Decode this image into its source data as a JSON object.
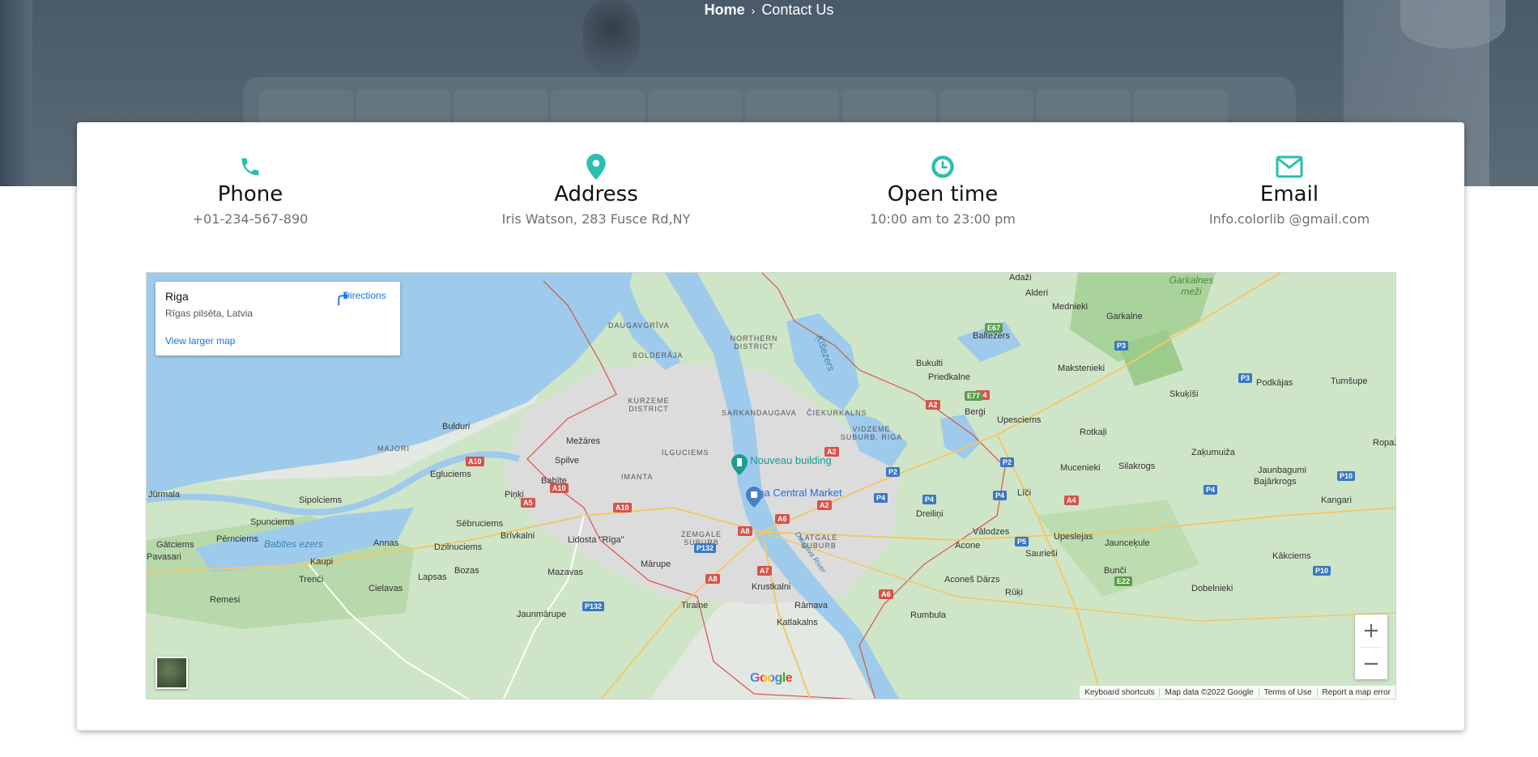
{
  "breadcrumb": {
    "home": "Home",
    "separator": "›",
    "current": "Contact Us"
  },
  "accent_color": "#2abfb0",
  "contact_items": [
    {
      "icon": "phone-icon",
      "title": "Phone",
      "value": "+01-234-567-890"
    },
    {
      "icon": "map-pin-icon",
      "title": "Address",
      "value": "Iris Watson, 283 Fusce Rd,NY"
    },
    {
      "icon": "clock-icon",
      "title": "Open time",
      "value": "10:00 am to 23:00 pm"
    },
    {
      "icon": "envelope-icon",
      "title": "Email",
      "value": "Info.colorlib @gmail.com"
    }
  ],
  "map": {
    "place_name": "Riga",
    "place_address": "Rīgas pilsēta, Latvia",
    "directions_label": "Directions",
    "view_larger_label": "View larger map",
    "zoom_in": "+",
    "zoom_out": "−",
    "google_logo": "Google",
    "footer": [
      "Keyboard shortcuts",
      "Map data ©2022 Google",
      "Terms of Use",
      "Report a map error"
    ],
    "pins": [
      {
        "label": "Art Nouveau building",
        "color": "#1a9e8f"
      },
      {
        "label": "Riga Central Market",
        "color": "#4a7fc8"
      }
    ],
    "places": [
      "Adaži",
      "Alderi",
      "Mednieki",
      "Garkalne",
      "Baltezers",
      "Bukulti",
      "Priedkalne",
      "Makstenieki",
      "Podkājas",
      "Tumšupe",
      "Skuķīši",
      "Berģi",
      "Upesciems",
      "Rotkaļi",
      "Ropaži",
      "Bulduri",
      "Mežāres",
      "Spilve",
      "Egluciems",
      "Babīte",
      "Piņķi",
      "Jūrmala",
      "Sipolciems",
      "Spunciems",
      "Pērnciems",
      "Gātciems",
      "Pavasari",
      "Kaupi",
      "Trenči",
      "Cielavas",
      "Lapsas",
      "Remesi",
      "Annas",
      "Sēbruciems",
      "Brīvkalni",
      "Dzilnuciems",
      "Bozas",
      "Mazavas",
      "Lidosta \"Rīga\"",
      "Mārupe",
      "Jaunmārupe",
      "Tiraine",
      "Krustkalni",
      "Rāmava",
      "Katlakalns",
      "Rumbula",
      "Dreiliņi",
      "Vālodzes",
      "Acone",
      "Saurieši",
      "Aconeš Dārzs",
      "Rūķi",
      "Upeslejas",
      "Jaunceķule",
      "Bunči",
      "Dobelnieki",
      "Kākciems",
      "Mucenieki",
      "Silakrogs",
      "Zaķumuiža",
      "Jaunbagumi",
      "Bajārkrogs",
      "Kangari",
      "Līči"
    ],
    "districts": [
      "DAUGAVGRĪVA",
      "BOLDERĀJA",
      "NORTHERN DISTRICT",
      "KURZEME DISTRICT",
      "SARKANDAUGAVA",
      "ČIEKURKALNS",
      "VIDZEME SUBURB, RIGA",
      "IĻĢUCIEMS",
      "IMANTA",
      "ZEMGALE SUBURB",
      "LATGALE SUBURB",
      "MAJORI"
    ],
    "water_labels": [
      "Ķīšezers",
      "Babītes ezers",
      "Daugava River",
      "Garkalnes meži"
    ],
    "road_badges": [
      {
        "text": "A10",
        "kind": "red"
      },
      {
        "text": "A10",
        "kind": "red"
      },
      {
        "text": "A10",
        "kind": "red"
      },
      {
        "text": "A5",
        "kind": "red"
      },
      {
        "text": "A8",
        "kind": "red"
      },
      {
        "text": "A8",
        "kind": "red"
      },
      {
        "text": "A7",
        "kind": "red"
      },
      {
        "text": "A6",
        "kind": "red"
      },
      {
        "text": "A6",
        "kind": "red"
      },
      {
        "text": "A2",
        "kind": "red"
      },
      {
        "text": "A2",
        "kind": "red"
      },
      {
        "text": "A2",
        "kind": "red"
      },
      {
        "text": "A4",
        "kind": "red"
      },
      {
        "text": "A4",
        "kind": "red"
      },
      {
        "text": "P2",
        "kind": "blue"
      },
      {
        "text": "P2",
        "kind": "blue"
      },
      {
        "text": "P3",
        "kind": "blue"
      },
      {
        "text": "P3",
        "kind": "blue"
      },
      {
        "text": "P4",
        "kind": "blue"
      },
      {
        "text": "P4",
        "kind": "blue"
      },
      {
        "text": "P4",
        "kind": "blue"
      },
      {
        "text": "P4",
        "kind": "blue"
      },
      {
        "text": "P5",
        "kind": "blue"
      },
      {
        "text": "P10",
        "kind": "blue"
      },
      {
        "text": "P10",
        "kind": "blue"
      },
      {
        "text": "P132",
        "kind": "blue"
      },
      {
        "text": "P132",
        "kind": "blue"
      },
      {
        "text": "E67",
        "kind": "green"
      },
      {
        "text": "E77",
        "kind": "green"
      },
      {
        "text": "E22",
        "kind": "green"
      }
    ]
  }
}
